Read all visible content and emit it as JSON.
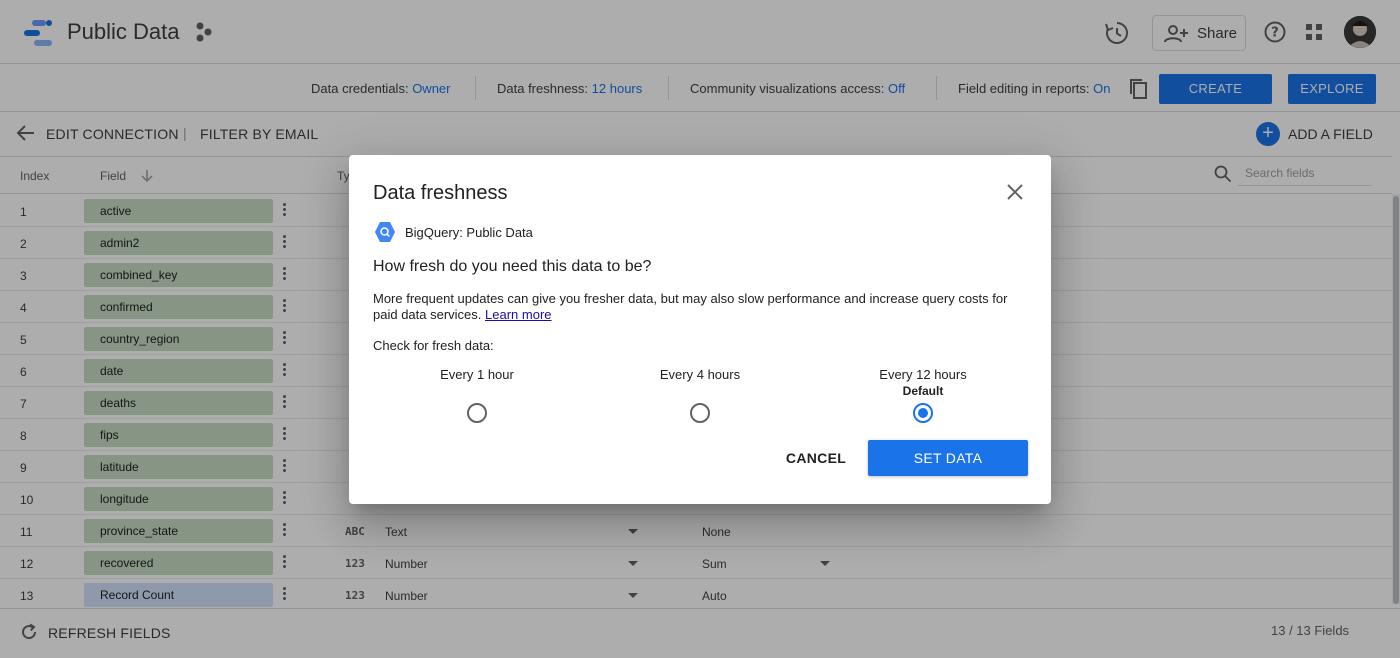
{
  "app": {
    "title": "Public Data",
    "share_label": "Share"
  },
  "infobar": {
    "credentials_label": "Data credentials:",
    "credentials_value": "Owner",
    "freshness_label": "Data freshness:",
    "freshness_value": "12 hours",
    "community_label": "Community visualizations access:",
    "community_value": "Off",
    "field_editing_label": "Field editing in reports:",
    "field_editing_value": "On",
    "create_report": "CREATE REPORT",
    "explore": "EXPLORE"
  },
  "toolbar": {
    "edit_connection": "EDIT CONNECTION",
    "divider": "|",
    "filter_by_email": "FILTER BY EMAIL",
    "add_field": "ADD A FIELD"
  },
  "table": {
    "headers": {
      "index": "Index",
      "field": "Field",
      "type": "Ty"
    },
    "search_placeholder": "Search fields",
    "rows": [
      {
        "index": "1",
        "field": "active"
      },
      {
        "index": "2",
        "field": "admin2"
      },
      {
        "index": "3",
        "field": "combined_key"
      },
      {
        "index": "4",
        "field": "confirmed"
      },
      {
        "index": "5",
        "field": "country_region"
      },
      {
        "index": "6",
        "field": "date"
      },
      {
        "index": "7",
        "field": "deaths"
      },
      {
        "index": "8",
        "field": "fips"
      },
      {
        "index": "9",
        "field": "latitude"
      },
      {
        "index": "10",
        "field": "longitude"
      },
      {
        "index": "11",
        "field": "province_state",
        "type_icon": "ABC",
        "type": "Text",
        "aggregation": "None"
      },
      {
        "index": "12",
        "field": "recovered",
        "type_icon": "123",
        "type": "Number",
        "aggregation": "Sum"
      },
      {
        "index": "13",
        "field": "Record Count",
        "type_icon": "123",
        "type": "Number",
        "aggregation": "Auto"
      }
    ]
  },
  "footer": {
    "refresh_fields": "REFRESH FIELDS",
    "field_count": "13 / 13 Fields"
  },
  "dialog": {
    "title": "Data freshness",
    "source": "BigQuery: Public Data",
    "question": "How fresh do you need this data to be?",
    "description": "More frequent updates can give you fresher data, but may also slow performance and increase query costs for paid data services.",
    "learn_more": "Learn more",
    "check_label": "Check for fresh data:",
    "options": [
      {
        "label": "Every 1 hour",
        "note": "",
        "selected": false
      },
      {
        "label": "Every 4 hours",
        "note": "",
        "selected": false
      },
      {
        "label": "Every 12 hours",
        "note": "Default",
        "selected": true
      }
    ],
    "cancel": "CANCEL",
    "confirm": "SET DATA FRESHNESS"
  },
  "colors": {
    "accent": "#1a73e8",
    "field_chip": "#c8dcc3",
    "metric_chip": "#d2e3fc"
  }
}
